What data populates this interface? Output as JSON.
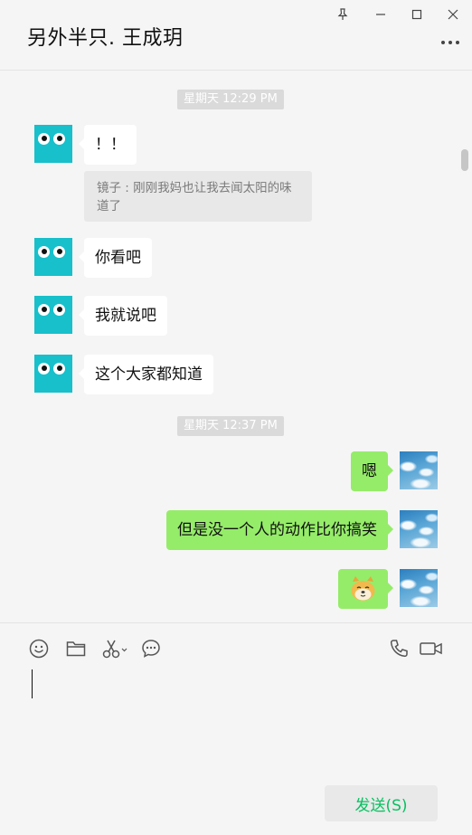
{
  "window": {
    "title": "另外半只. 王成玥",
    "controls": [
      "pin-icon",
      "minimize-icon",
      "maximize-icon",
      "close-icon"
    ]
  },
  "chat": {
    "timestamp_1": "星期天 12:29 PM",
    "timestamp_2": "星期天 12:37 PM",
    "messages": [
      {
        "side": "left",
        "text": "！！"
      },
      {
        "side": "left",
        "text": "你看吧"
      },
      {
        "side": "left",
        "text": "我就说吧"
      },
      {
        "side": "left",
        "text": "这个大家都知道"
      },
      {
        "side": "right",
        "text": "嗯"
      },
      {
        "side": "right",
        "text": "但是没一个人的动作比你搞笑"
      },
      {
        "side": "right",
        "text": "",
        "sticker": "doge-emoji"
      }
    ],
    "quote": "镜子 : 刚刚我妈也让我去闻太阳的味道了"
  },
  "toolbar": {
    "left_icons": [
      "emoji-icon",
      "folder-icon",
      "scissors-icon",
      "chat-history-icon"
    ],
    "right_icons": [
      "phone-icon",
      "video-icon"
    ]
  },
  "composer": {
    "value": "",
    "send_label": "发送(S)"
  },
  "colors": {
    "accent": "#07c160",
    "bubble_right": "#95ec69",
    "bubble_left": "#ffffff",
    "avatar_left": "#17c0cb"
  }
}
